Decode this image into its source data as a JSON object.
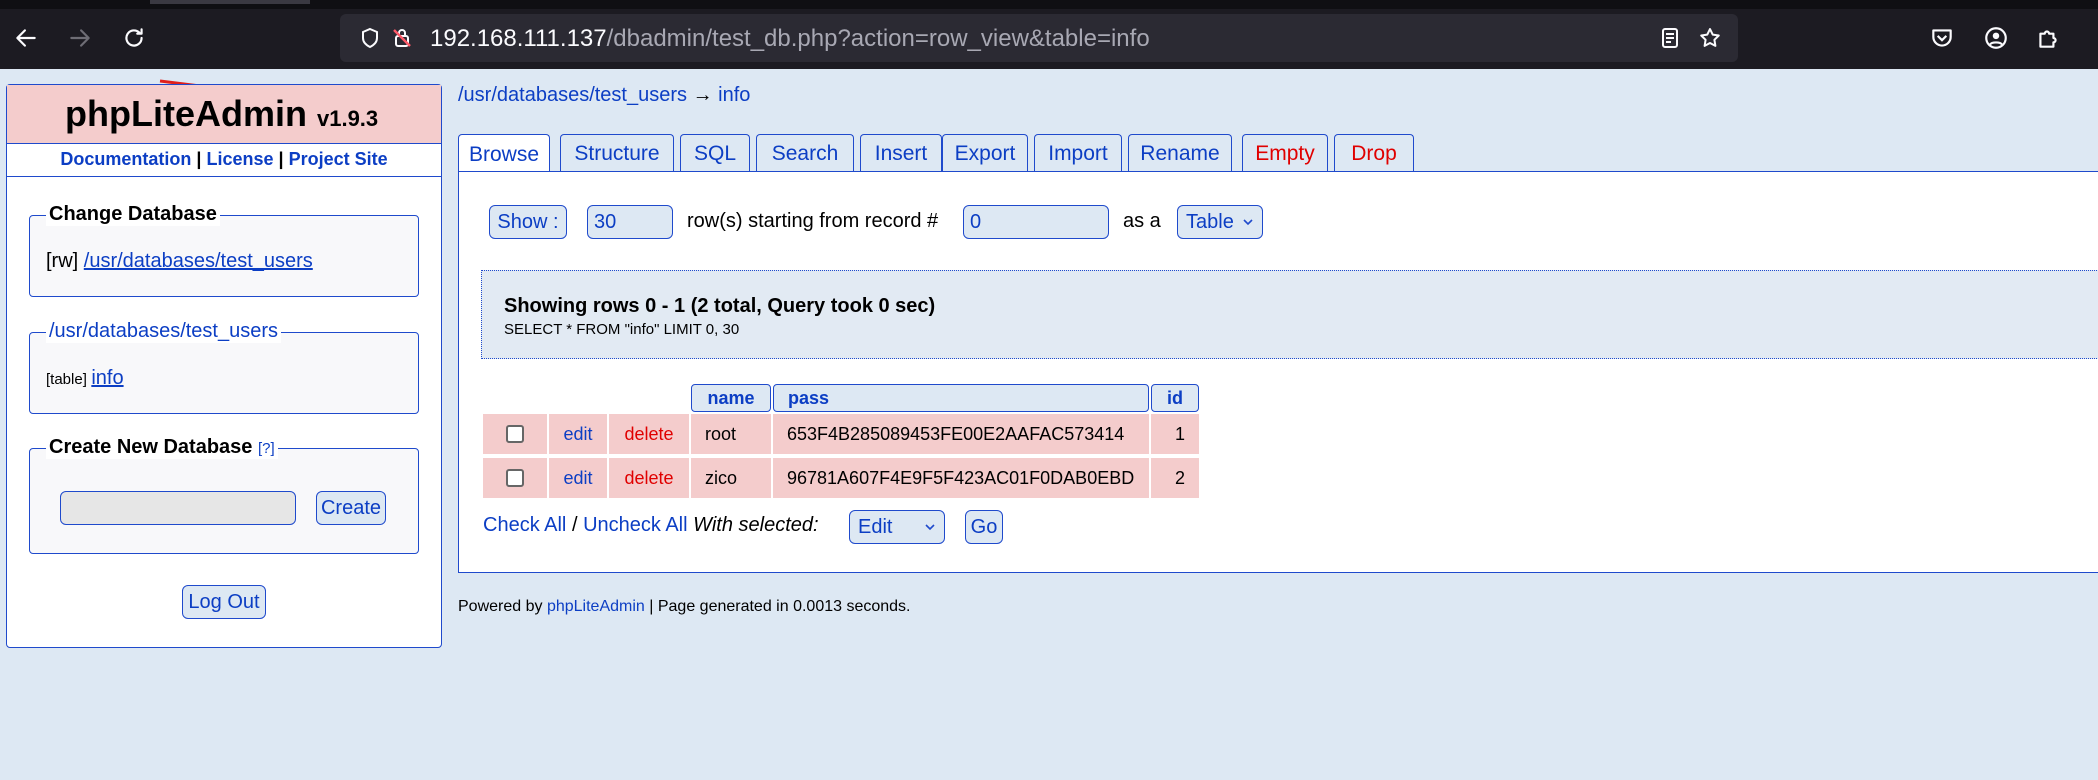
{
  "browser": {
    "url_host": "192.168.111.137",
    "url_path": "/dbadmin/test_db.php?action=row_view&table=info"
  },
  "sidebar": {
    "title": "phpLiteAdmin",
    "version": "v1.9.3",
    "links": {
      "documentation": "Documentation",
      "sep1": "|",
      "license": "License",
      "sep2": "|",
      "project_site": "Project Site"
    },
    "change_database": {
      "legend": "Change Database",
      "prefix": "[rw]",
      "db_link": "/usr/databases/test_users"
    },
    "db_tables": {
      "legend": "/usr/databases/test_users",
      "prefix": "[table]",
      "table_link": "info"
    },
    "create_db": {
      "legend": "Create New Database",
      "help": "[?]",
      "input_value": "",
      "button": "Create"
    },
    "logout": "Log Out"
  },
  "main": {
    "breadcrumb": {
      "db": "/usr/databases/test_users",
      "arrow": "→",
      "table": "info"
    },
    "tabs": [
      {
        "label": "Browse"
      },
      {
        "label": "Structure"
      },
      {
        "label": "SQL"
      },
      {
        "label": "Search"
      },
      {
        "label": "Insert"
      },
      {
        "label": "Export"
      },
      {
        "label": "Import"
      },
      {
        "label": "Rename"
      },
      {
        "label": "Empty"
      },
      {
        "label": "Drop"
      }
    ],
    "controls": {
      "show_button": "Show :",
      "rows_value": "30",
      "rows_label": "row(s) starting from record #",
      "start_value": "0",
      "as_label": "as a",
      "view_select": "Table"
    },
    "query": {
      "summary": "Showing rows 0 - 1 (2 total, Query took 0 sec)",
      "sql": "SELECT * FROM \"info\" LIMIT 0, 30"
    },
    "table": {
      "columns": [
        "name",
        "pass",
        "id"
      ],
      "edit_label": "edit",
      "delete_label": "delete",
      "rows": [
        {
          "name": "root",
          "pass": "653F4B285089453FE00E2AAFAC573414",
          "id": "1"
        },
        {
          "name": "zico",
          "pass": "96781A607F4E9F5F423AC01F0DAB0EBD",
          "id": "2"
        }
      ]
    },
    "bulk": {
      "check_all": "Check All",
      "sep": "/",
      "uncheck_all": "Uncheck All",
      "with_selected": "With selected:",
      "action_select": "Edit",
      "go": "Go"
    }
  },
  "footer": {
    "powered_by": "Powered by",
    "link": "phpLiteAdmin",
    "rest": "| Page generated in 0.0013 seconds."
  }
}
